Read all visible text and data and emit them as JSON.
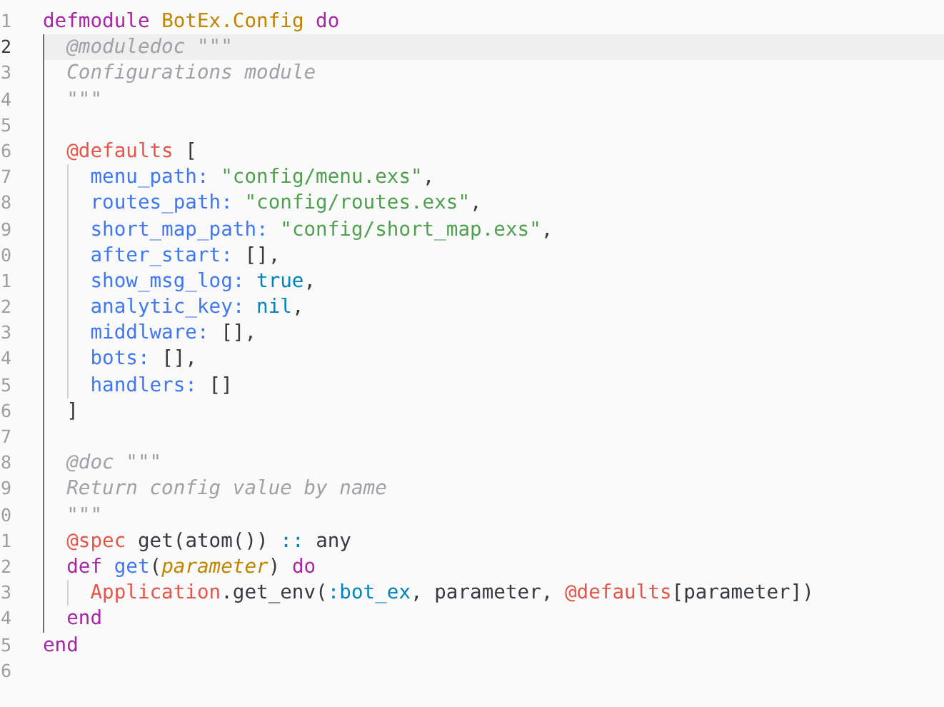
{
  "lines": [
    {
      "number": "1",
      "current": false,
      "tokens": [
        {
          "kind": "keyword",
          "text": "defmodule"
        },
        {
          "kind": "module",
          "text": " BotEx.Config"
        },
        {
          "kind": "keyword",
          "text": " do"
        }
      ]
    },
    {
      "number": "2",
      "current": true,
      "tokens": [
        {
          "kind": "doc",
          "text": "  @moduledoc \"\"\""
        }
      ]
    },
    {
      "number": "3",
      "current": false,
      "tokens": [
        {
          "kind": "doc",
          "text": "  Configurations module"
        }
      ]
    },
    {
      "number": "4",
      "current": false,
      "tokens": [
        {
          "kind": "doc",
          "text": "  \"\"\""
        }
      ]
    },
    {
      "number": "5",
      "current": false
    },
    {
      "number": "6",
      "current": false,
      "tokens": [
        {
          "kind": "attr",
          "text": "  @defaults"
        },
        {
          "kind": "plain",
          "text": " ["
        }
      ]
    },
    {
      "number": "7",
      "current": false,
      "tokens": [
        {
          "kind": "key",
          "text": "    menu_path:"
        },
        {
          "kind": "string",
          "text": " \"config/menu.exs\""
        },
        {
          "kind": "plain",
          "text": ","
        }
      ]
    },
    {
      "number": "8",
      "current": false,
      "tokens": [
        {
          "kind": "key",
          "text": "    routes_path:"
        },
        {
          "kind": "string",
          "text": " \"config/routes.exs\""
        },
        {
          "kind": "plain",
          "text": ","
        }
      ]
    },
    {
      "number": "9",
      "current": false,
      "tokens": [
        {
          "kind": "key",
          "text": "    short_map_path:"
        },
        {
          "kind": "string",
          "text": " \"config/short_map.exs\""
        },
        {
          "kind": "plain",
          "text": ","
        }
      ]
    },
    {
      "number": "0",
      "current": false,
      "tokens": [
        {
          "kind": "key",
          "text": "    after_start:"
        },
        {
          "kind": "plain",
          "text": " [],"
        }
      ]
    },
    {
      "number": "1",
      "current": false,
      "tokens": [
        {
          "kind": "key",
          "text": "    show_msg_log:"
        },
        {
          "kind": "literal",
          "text": " true"
        },
        {
          "kind": "plain",
          "text": ","
        }
      ]
    },
    {
      "number": "2",
      "current": false,
      "tokens": [
        {
          "kind": "key",
          "text": "    analytic_key:"
        },
        {
          "kind": "literal",
          "text": " nil"
        },
        {
          "kind": "plain",
          "text": ","
        }
      ]
    },
    {
      "number": "3",
      "current": false,
      "tokens": [
        {
          "kind": "key",
          "text": "    middlware:"
        },
        {
          "kind": "plain",
          "text": " [],"
        }
      ]
    },
    {
      "number": "4",
      "current": false,
      "tokens": [
        {
          "kind": "key",
          "text": "    bots:"
        },
        {
          "kind": "plain",
          "text": " [],"
        }
      ]
    },
    {
      "number": "5",
      "current": false,
      "tokens": [
        {
          "kind": "key",
          "text": "    handlers:"
        },
        {
          "kind": "plain",
          "text": " []"
        }
      ]
    },
    {
      "number": "6",
      "current": false,
      "tokens": [
        {
          "kind": "plain",
          "text": "  ]"
        }
      ]
    },
    {
      "number": "7",
      "current": false
    },
    {
      "number": "8",
      "current": false,
      "tokens": [
        {
          "kind": "doc",
          "text": "  @doc \"\"\""
        }
      ]
    },
    {
      "number": "9",
      "current": false,
      "tokens": [
        {
          "kind": "doc",
          "text": "  Return config value by name"
        }
      ]
    },
    {
      "number": "0",
      "current": false,
      "tokens": [
        {
          "kind": "doc",
          "text": "  \"\"\""
        }
      ]
    },
    {
      "number": "1",
      "current": false,
      "tokens": [
        {
          "kind": "attr",
          "text": "  @spec"
        },
        {
          "kind": "plain",
          "text": " get(atom()) "
        },
        {
          "kind": "operator",
          "text": "::"
        },
        {
          "kind": "plain",
          "text": " any"
        }
      ]
    },
    {
      "number": "2",
      "current": false,
      "tokens": [
        {
          "kind": "keyword",
          "text": "  def"
        },
        {
          "kind": "function",
          "text": " get"
        },
        {
          "kind": "plain",
          "text": "("
        },
        {
          "kind": "param",
          "text": "parameter"
        },
        {
          "kind": "plain",
          "text": ") "
        },
        {
          "kind": "keyword",
          "text": "do"
        }
      ]
    },
    {
      "number": "3",
      "current": false,
      "tokens": [
        {
          "kind": "attr",
          "text": "    Application"
        },
        {
          "kind": "plain",
          "text": ".get_env("
        },
        {
          "kind": "literal",
          "text": ":bot_ex"
        },
        {
          "kind": "plain",
          "text": ", parameter, "
        },
        {
          "kind": "attr",
          "text": "@defaults"
        },
        {
          "kind": "plain",
          "text": "[parameter])"
        }
      ]
    },
    {
      "number": "4",
      "current": false,
      "tokens": [
        {
          "kind": "keyword",
          "text": "  end"
        }
      ]
    },
    {
      "number": "5",
      "current": false,
      "tokens": [
        {
          "kind": "keyword",
          "text": "end"
        }
      ]
    },
    {
      "number": "6",
      "current": false
    }
  ]
}
